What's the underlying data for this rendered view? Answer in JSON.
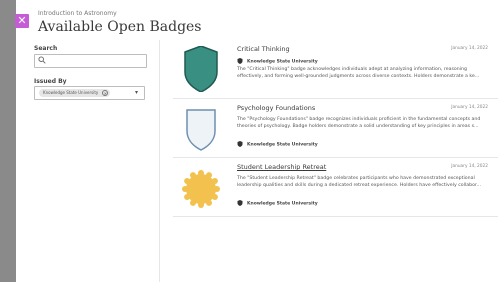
{
  "header": {
    "course": "Introduction to Astronomy",
    "title": "Available Open Badges"
  },
  "sidebar": {
    "search_label": "Search",
    "search_placeholder": "",
    "issued_by_label": "Issued By",
    "issued_by_selected": "Knowledge State University"
  },
  "badges": [
    {
      "title": "Critical Thinking",
      "date": "January 14, 2022",
      "issuer": "Knowledge State University",
      "description": "The \"Critical Thinking\" badge acknowledges individuals adept at analyzing information, reasoning effectively, and forming well-grounded judgments across diverse contexts. Holders demonstrate a ke...",
      "shape": "shield",
      "color": "#3a8f83"
    },
    {
      "title": "Psychology Foundations",
      "date": "January 14, 2022",
      "issuer": "Knowledge State University",
      "description": "The \"Psychology Foundations\" badge recognizes individuals proficient in the fundamental concepts and theories of psychology. Badge holders demonstrate a solid understanding of key principles in areas s...",
      "shape": "shield-outline",
      "color": "#eef3f8"
    },
    {
      "title": "Student Leadership Retreat",
      "date": "January 14, 2022",
      "issuer": "Knowledge State University",
      "description": "The \"Student Leadership Retreat\" badge celebrates participants who have demonstrated exceptional leadership qualities and skills during a dedicated retreat experience. Holders have effectively collabor...",
      "shape": "seal",
      "color": "#f2c14e"
    }
  ],
  "colors": {
    "accent": "#c65bd6",
    "strip": "#8a8a8a"
  }
}
